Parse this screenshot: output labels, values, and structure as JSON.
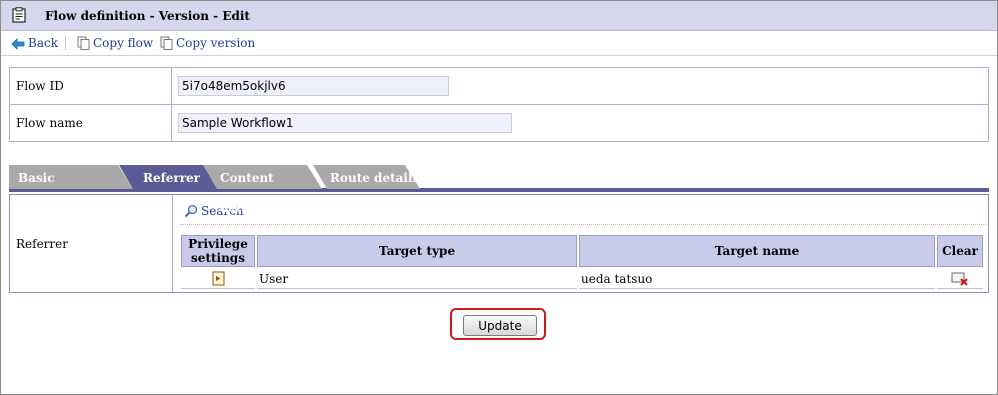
{
  "titlebar": {
    "title": "Flow definition - Version - Edit",
    "icon": "clipboard-icon"
  },
  "toolbar": {
    "back_label": "Back",
    "copy_flow_label": "Copy flow",
    "copy_version_label": "Copy version"
  },
  "form": {
    "flow_id_label": "Flow ID",
    "flow_id_value": "5i7o48em5okjlv6",
    "flow_name_label": "Flow name",
    "flow_name_value": "Sample Workflow1"
  },
  "tabs": [
    {
      "label": "Basic information",
      "active": false
    },
    {
      "label": "Referrer",
      "active": true
    },
    {
      "label": "Content details",
      "active": false
    },
    {
      "label": "Route details",
      "active": false
    }
  ],
  "referrer": {
    "label": "Referrer",
    "search_label": "Search",
    "columns": {
      "privilege_line1": "Privilege",
      "privilege_line2": "settings",
      "target_type": "Target type",
      "target_name": "Target name",
      "clear": "Clear"
    },
    "rows": [
      {
        "target_type": "User",
        "target_name": "ueda tatsuo"
      }
    ]
  },
  "update_label": "Update",
  "colors": {
    "titlebar_bg": "#d6d6ef",
    "tab_active": "#5b5b96",
    "tab_inactive": "#a9a9a9",
    "link": "#1a3fa0",
    "highlight_ring": "#cc1a1a"
  }
}
